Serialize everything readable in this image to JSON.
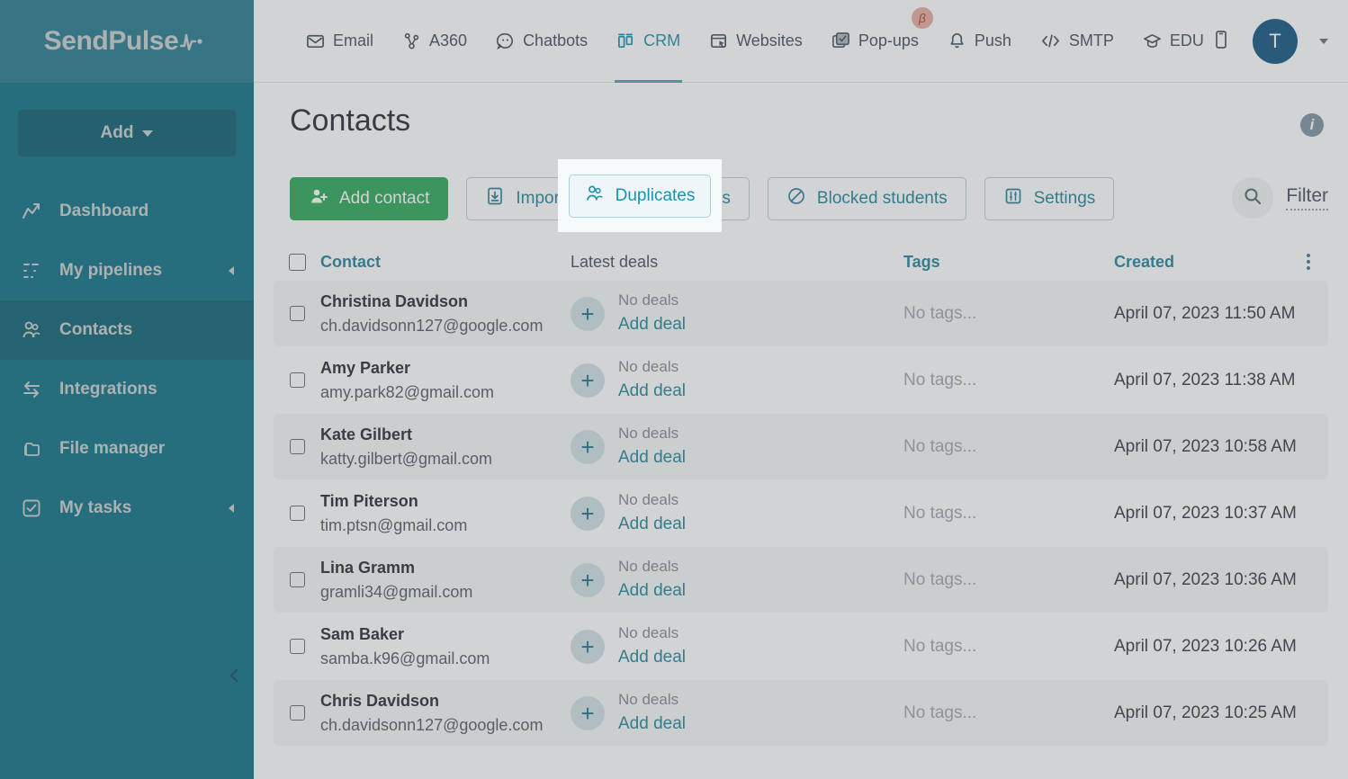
{
  "brand": {
    "name": "SendPulse",
    "logo_icon": "pulse-wave-icon",
    "header_color": "#1e7589",
    "sidebar_color": "#04697f",
    "accent_color": "#1b7e96",
    "primary_button_color": "#22a44e"
  },
  "sidebar": {
    "add_button": {
      "label": "Add",
      "icon": "chevron-down-icon"
    },
    "items": [
      {
        "label": "Dashboard",
        "icon": "chart-line-icon",
        "active": false,
        "has_arrow": false
      },
      {
        "label": "My pipelines",
        "icon": "pipeline-icon",
        "active": false,
        "has_arrow": true
      },
      {
        "label": "Contacts",
        "icon": "people-icon",
        "active": true,
        "has_arrow": false
      },
      {
        "label": "Integrations",
        "icon": "arrows-swap-icon",
        "active": false,
        "has_arrow": false
      },
      {
        "label": "File manager",
        "icon": "folder-icon",
        "active": false,
        "has_arrow": false
      },
      {
        "label": "My tasks",
        "icon": "checkbox-icon",
        "active": false,
        "has_arrow": true
      }
    ],
    "collapse_icon": "chevron-left-icon"
  },
  "topnav": {
    "items": [
      {
        "label": "Email",
        "icon": "envelope-icon",
        "active": false,
        "badge": ""
      },
      {
        "label": "A360",
        "icon": "nodes-icon",
        "active": false,
        "badge": ""
      },
      {
        "label": "Chatbots",
        "icon": "chat-icon",
        "active": false,
        "badge": ""
      },
      {
        "label": "CRM",
        "icon": "kanban-icon",
        "active": true,
        "badge": ""
      },
      {
        "label": "Websites",
        "icon": "window-cursor-icon",
        "active": false,
        "badge": ""
      },
      {
        "label": "Pop-ups",
        "icon": "popup-icon",
        "active": false,
        "badge": "β"
      },
      {
        "label": "Push",
        "icon": "bell-icon",
        "active": false,
        "badge": ""
      },
      {
        "label": "SMTP",
        "icon": "code-icon",
        "active": false,
        "badge": ""
      },
      {
        "label": "EDU",
        "icon": "graduation-cap-icon",
        "active": false,
        "badge": ""
      }
    ],
    "mobile_icon": "mobile-phone-icon",
    "avatar_initial": "T",
    "avatar_caret_icon": "chevron-down-icon"
  },
  "page": {
    "title": "Contacts",
    "info_icon": "info-icon"
  },
  "toolbar": {
    "buttons": [
      {
        "label": "Add contact",
        "icon": "user-plus-icon",
        "style": "primary"
      },
      {
        "label": "Import",
        "icon": "import-icon",
        "style": "ghost"
      },
      {
        "label": "Duplicates",
        "icon": "people-icon",
        "style": "highlighted"
      },
      {
        "label": "Blocked students",
        "icon": "ban-icon",
        "style": "ghost"
      },
      {
        "label": "Settings",
        "icon": "sliders-icon",
        "style": "ghost"
      }
    ],
    "search_icon": "search-icon",
    "filter_label": "Filter"
  },
  "table": {
    "columns": [
      "Contact",
      "Latest deals",
      "Tags",
      "Created"
    ],
    "menu_icon": "kebab-menu-icon",
    "rows": [
      {
        "name": "Christina Davidson",
        "email": "ch.davidsonn127@google.com",
        "deals_status": "No deals",
        "deals_action": "Add deal",
        "tags": "No tags...",
        "created": "April 07, 2023 11:50 AM"
      },
      {
        "name": "Amy Parker",
        "email": "amy.park82@gmail.com",
        "deals_status": "No deals",
        "deals_action": "Add deal",
        "tags": "No tags...",
        "created": "April 07, 2023 11:38 AM"
      },
      {
        "name": "Kate Gilbert",
        "email": "katty.gilbert@gmail.com",
        "deals_status": "No deals",
        "deals_action": "Add deal",
        "tags": "No tags...",
        "created": "April 07, 2023 10:58 AM"
      },
      {
        "name": "Tim Piterson",
        "email": "tim.ptsn@gmail.com",
        "deals_status": "No deals",
        "deals_action": "Add deal",
        "tags": "No tags...",
        "created": "April 07, 2023 10:37 AM"
      },
      {
        "name": "Lina Gramm",
        "email": "gramli34@gmail.com",
        "deals_status": "No deals",
        "deals_action": "Add deal",
        "tags": "No tags...",
        "created": "April 07, 2023 10:36 AM"
      },
      {
        "name": "Sam Baker",
        "email": "samba.k96@gmail.com",
        "deals_status": "No deals",
        "deals_action": "Add deal",
        "tags": "No tags...",
        "created": "April 07, 2023 10:26 AM"
      },
      {
        "name": "Chris Davidson",
        "email": "ch.davidsonn127@google.com",
        "deals_status": "No deals",
        "deals_action": "Add deal",
        "tags": "No tags...",
        "created": "April 07, 2023 10:25 AM"
      }
    ]
  },
  "spotlight": {
    "target_label": "Duplicates",
    "target_icon": "people-icon"
  }
}
